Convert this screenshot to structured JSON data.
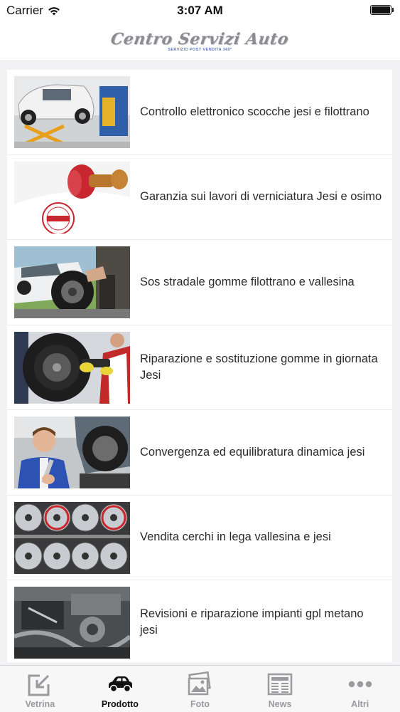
{
  "status_bar": {
    "carrier": "Carrier",
    "time": "3:07 AM"
  },
  "header": {
    "logo_text": "Centro Servizi Auto",
    "logo_subtitle": "SERVIZIO POST VENDITA 360°"
  },
  "list": {
    "items": [
      {
        "title": "Controllo elettronico scocche jesi e filottrano",
        "image": "car-on-lift"
      },
      {
        "title": "Garanzia sui lavori di verniciatura Jesi e osimo",
        "image": "guarantee-stamp"
      },
      {
        "title": "Sos stradale gomme filottrano e vallesina",
        "image": "tire-change-roadside"
      },
      {
        "title": "Riparazione e sostituzione gomme in giornata Jesi",
        "image": "tire-repair-mechanic"
      },
      {
        "title": "Convergenza ed equilibratura dinamica jesi",
        "image": "mechanic-with-wrench"
      },
      {
        "title": "Vendita cerchi in lega vallesina e jesi",
        "image": "alloy-rims-rack"
      },
      {
        "title": "Revisioni e riparazione impianti gpl metano jesi",
        "image": "engine-bay"
      }
    ]
  },
  "tab_bar": {
    "tabs": [
      {
        "label": "Vetrina",
        "icon": "vetrina-icon",
        "active": false
      },
      {
        "label": "Prodotto",
        "icon": "car-icon",
        "active": true
      },
      {
        "label": "Foto",
        "icon": "photo-icon",
        "active": false
      },
      {
        "label": "News",
        "icon": "newspaper-icon",
        "active": false
      },
      {
        "label": "Altri",
        "icon": "more-dots-icon",
        "active": false
      }
    ]
  },
  "colors": {
    "background": "#f2f2f4",
    "tab_active": "#111111",
    "tab_inactive": "#9a9a9f",
    "logo_gray": "#8b8b91",
    "logo_blue": "#5a78b8"
  }
}
